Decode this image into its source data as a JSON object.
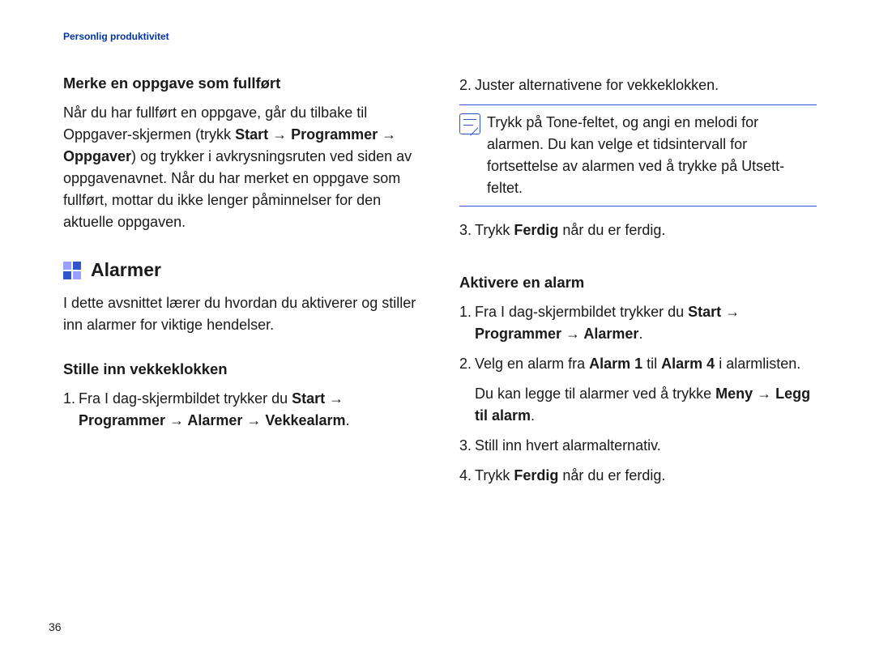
{
  "header": {
    "category": "Personlig produktivitet"
  },
  "left": {
    "h3a": "Merke en oppgave som fullført",
    "p1_a": "Når du har fullført en oppgave, går du tilbake til Oppgaver-skjermen (trykk ",
    "p1_b": "Start → Programmer → Oppgaver",
    "p1_c": ") og trykker i avkrysningsruten ved siden av oppgavenavnet. Når du har merket en oppgave som fullført, mottar du ikke lenger påminnelser for den aktuelle oppgaven.",
    "h2": "Alarmer",
    "p2": "I dette avsnittet lærer du hvordan du aktiverer og stiller inn alarmer for viktige hendelser.",
    "h3b": "Stille inn vekkeklokken",
    "ol1": {
      "n1": "1.",
      "t1a": "Fra I dag-skjermbildet trykker du ",
      "t1b": "Start → Programmer → Alarmer → Vekkealarm",
      "t1c": "."
    }
  },
  "right": {
    "ol_top": {
      "n2": "2.",
      "t2": "Juster alternativene for vekkeklokken.",
      "n3": "3.",
      "t3a": "Trykk ",
      "t3b": "Ferdig",
      "t3c": " når du er ferdig."
    },
    "note": "Trykk på Tone-feltet, og angi en melodi for alarmen. Du kan velge et tidsintervall for fortsettelse av alarmen ved å trykke på Utsett-feltet.",
    "h3": "Aktivere en alarm",
    "ol2": {
      "n1": "1.",
      "t1a": "Fra I dag-skjermbildet trykker du ",
      "t1b": "Start → Programmer → Alarmer",
      "t1c": ".",
      "n2": "2.",
      "t2a": "Velg en alarm fra ",
      "t2b": "Alarm 1",
      "t2c": " til ",
      "t2d": "Alarm 4",
      "t2e": " i alarmlisten.",
      "t2f": "Du kan legge til alarmer ved å trykke ",
      "t2g": "Meny → Legg til alarm",
      "t2h": ".",
      "n3": "3.",
      "t3": "Still inn hvert alarmalternativ.",
      "n4": "4.",
      "t4a": "Trykk ",
      "t4b": "Ferdig",
      "t4c": " når du er ferdig."
    }
  },
  "page_number": "36"
}
